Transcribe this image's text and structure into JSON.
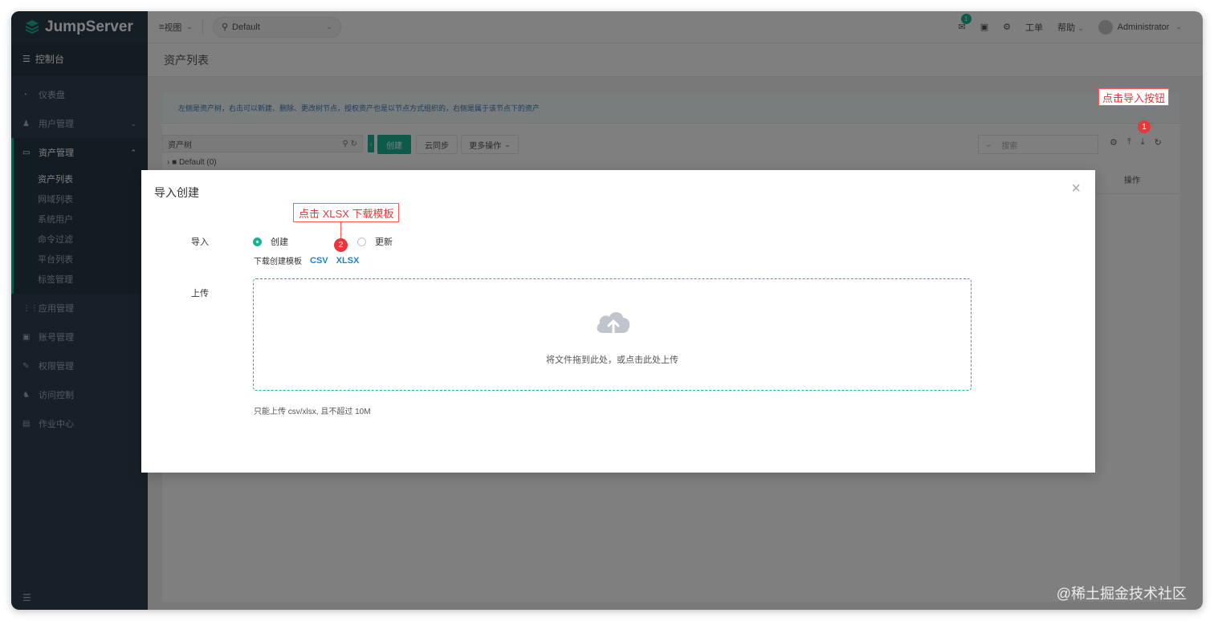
{
  "app": {
    "logo_text": "JumpServer"
  },
  "topbar": {
    "view_label": "视图",
    "org_select": "Default",
    "mail_count": "1",
    "tickets_label": "工单",
    "help_label": "帮助",
    "user_name": "Administrator"
  },
  "sidebar": {
    "console_label": "控制台",
    "items": [
      {
        "label": "仪表盘",
        "icon": "dashboard-icon"
      },
      {
        "label": "用户管理",
        "icon": "users-icon"
      },
      {
        "label": "资产管理",
        "icon": "assets-icon"
      },
      {
        "label": "应用管理",
        "icon": "apps-icon"
      },
      {
        "label": "账号管理",
        "icon": "accounts-icon"
      },
      {
        "label": "权限管理",
        "icon": "perms-icon"
      },
      {
        "label": "访问控制",
        "icon": "acl-icon"
      },
      {
        "label": "作业中心",
        "icon": "jobs-icon"
      }
    ],
    "sub_items": [
      "资产列表",
      "网域列表",
      "系统用户",
      "命令过滤",
      "平台列表",
      "标签管理"
    ]
  },
  "page": {
    "title": "资产列表",
    "alert_text": "左侧是资产树，右击可以新建、删除、更改树节点，授权资产也是以节点方式组织的，右侧是属于该节点下的资产",
    "tree_search_label": "资产树",
    "tree_node": "Default (0)",
    "create_button": "创建",
    "sync_button": "云同步",
    "more_button": "更多操作",
    "search_placeholder": "搜索",
    "ops_header": "操作"
  },
  "annotations": {
    "import_callout": "点击导入按钮",
    "badge_1": "1",
    "xlsx_callout": "点击 XLSX 下载模板",
    "badge_2": "2"
  },
  "modal": {
    "title": "导入创建",
    "import_label": "导入",
    "radio_create": "创建",
    "radio_update": "更新",
    "selected": "创建",
    "template_label": "下载创建模板",
    "csv_link": "CSV",
    "xlsx_link": "XLSX",
    "upload_label": "上传",
    "drop_text": "将文件拖到此处，或点击此处上传",
    "upload_tip": "只能上传 csv/xlsx, 且不超过 10M"
  },
  "watermark": "@稀土掘金技术社区",
  "colors": {
    "sidebar_bg": "#2f4050",
    "accent": "#1ab394",
    "link": "#1c84c6",
    "annotation_red": "#e5383b"
  }
}
